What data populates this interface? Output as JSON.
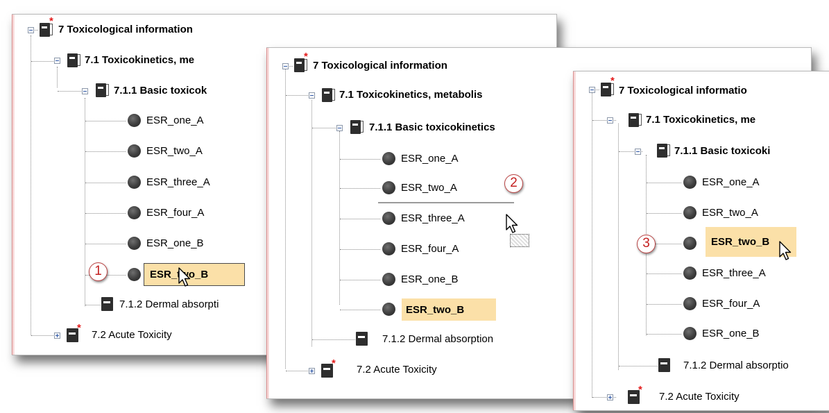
{
  "tree": {
    "root": "7 Toxicological information",
    "sub_full": "7.1 Toxicokinetics, metabolis",
    "sub_p1": "7.1 Toxicokinetics, me",
    "sub_p3": "7.1 Toxicokinetics, me",
    "basic_p1": "7.1.1 Basic toxicok",
    "basic_p2": "7.1.1 Basic toxicokinetics",
    "basic_p3": "7.1.1 Basic toxicoki",
    "root_p3": "7 Toxicological informatio",
    "dermal_p1": "7.1.2 Dermal absorpti",
    "dermal_p2": "7.1.2 Dermal absorption",
    "dermal_p3": "7.1.2 Dermal absorptio",
    "acute": "7.2 Acute Toxicity"
  },
  "panel1_items": [
    "ESR_one_A",
    "ESR_two_A",
    "ESR_three_A",
    "ESR_four_A",
    "ESR_one_B",
    "ESR_two_B"
  ],
  "panel2_items": [
    "ESR_one_A",
    "ESR_two_A",
    "ESR_three_A",
    "ESR_four_A",
    "ESR_one_B",
    "ESR_two_B"
  ],
  "panel3_items": [
    "ESR_one_A",
    "ESR_two_A",
    "ESR_two_B",
    "ESR_three_A",
    "ESR_four_A",
    "ESR_one_B"
  ],
  "steps": [
    "1",
    "2",
    "3"
  ],
  "colors": {
    "highlight": "#fbe0a8",
    "step_number": "#c42020",
    "required_star": "#e31b1b"
  }
}
